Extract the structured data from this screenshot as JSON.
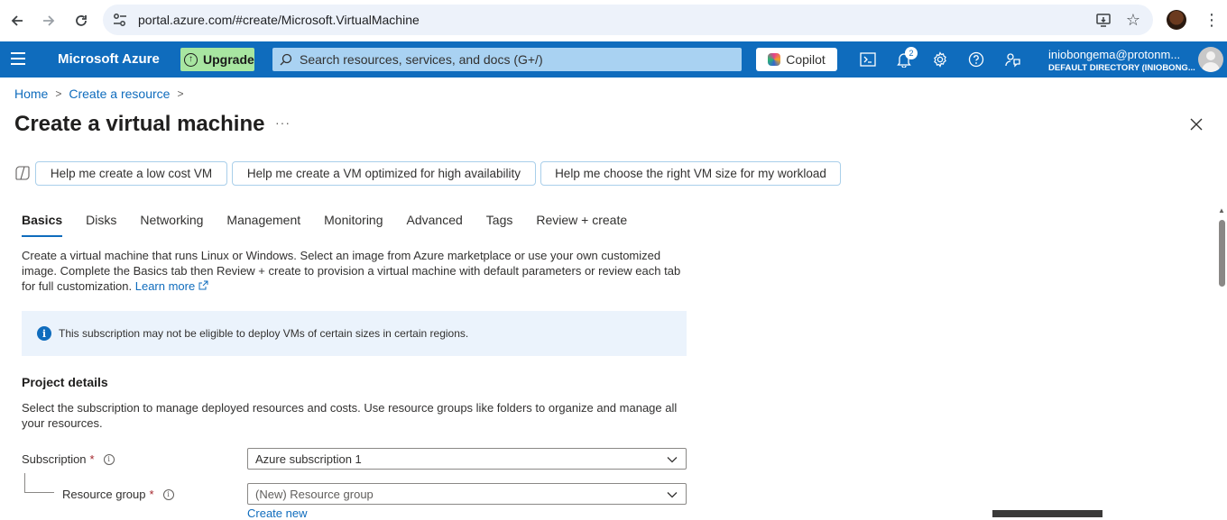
{
  "browser": {
    "url": "portal.azure.com/#create/Microsoft.VirtualMachine"
  },
  "topbar": {
    "brand": "Microsoft Azure",
    "upgrade_label": "Upgrade",
    "search_placeholder": "Search resources, services, and docs (G+/)",
    "copilot_label": "Copilot",
    "notification_count": "2",
    "account_email": "iniobongema@protonm...",
    "account_directory": "DEFAULT DIRECTORY (INIOBONG..."
  },
  "breadcrumb": {
    "home": "Home",
    "create_resource": "Create a resource"
  },
  "page": {
    "title": "Create a virtual machine",
    "more": "···"
  },
  "prompts": [
    "Help me create a low cost VM",
    "Help me create a VM optimized for high availability",
    "Help me choose the right VM size for my workload"
  ],
  "tabs": [
    "Basics",
    "Disks",
    "Networking",
    "Management",
    "Monitoring",
    "Advanced",
    "Tags",
    "Review + create"
  ],
  "active_tab": "Basics",
  "intro": {
    "text": "Create a virtual machine that runs Linux or Windows. Select an image from Azure marketplace or use your own customized image. Complete the Basics tab then Review + create to provision a virtual machine with default parameters or review each tab for full customization.",
    "learn_more": "Learn more"
  },
  "info_message": "This subscription may not be eligible to deploy VMs of certain sizes in certain regions.",
  "project_details": {
    "heading": "Project details",
    "description": "Select the subscription to manage deployed resources and costs. Use resource groups like folders to organize and manage all your resources.",
    "subscription_label": "Subscription",
    "subscription_value": "Azure subscription 1",
    "resource_group_label": "Resource group",
    "resource_group_value": "(New) Resource group",
    "create_new": "Create new",
    "required_mark": "*"
  },
  "colors": {
    "azure_blue": "#0f6cbd",
    "upgrade_green": "#a8e6a1",
    "info_bg": "#ebf3fc"
  }
}
